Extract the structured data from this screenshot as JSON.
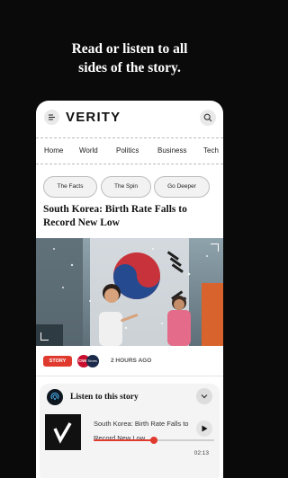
{
  "promo": {
    "line1": "Read or listen to all",
    "line2": "sides of the story."
  },
  "app": {
    "logo": "VERITY",
    "menu_icon": "menu-icon",
    "search_icon": "search-icon"
  },
  "nav": {
    "items": [
      {
        "label": "Home"
      },
      {
        "label": "World"
      },
      {
        "label": "Politics"
      },
      {
        "label": "Business"
      },
      {
        "label": "Tech"
      }
    ]
  },
  "chips": [
    {
      "label": "The Facts"
    },
    {
      "label": "The Spin"
    },
    {
      "label": "Go Deeper"
    }
  ],
  "story": {
    "title": "South Korea: Birth Rate Falls to Record New Low",
    "badge": "STORY",
    "time_ago": "2 HOURS AGO",
    "sources": [
      "CNN",
      "Times"
    ]
  },
  "listen": {
    "label": "Listen to this story",
    "track_title": "South Korea: Birth Rate Falls to Record New Low",
    "progress": 0.5,
    "time": "02:13"
  },
  "colors": {
    "accent": "#e03a2f",
    "background": "#0a0a0a"
  }
}
